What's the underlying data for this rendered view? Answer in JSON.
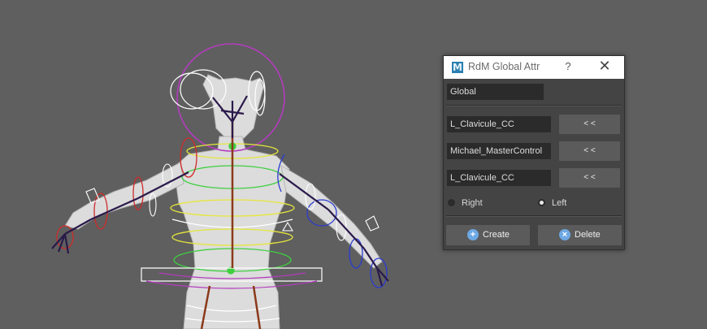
{
  "dialog": {
    "title": "RdM Global Attr",
    "logo_letter": "M",
    "help_label": "?",
    "close_label": "✕",
    "global_field": "Global",
    "rows": [
      {
        "value": "L_Clavicule_CC",
        "button_label": "< <"
      },
      {
        "value": "Michael_MasterControl",
        "button_label": "< <"
      },
      {
        "value": "L_Clavicule_CC",
        "button_label": "< <"
      }
    ],
    "side_options": [
      {
        "label": "Right",
        "selected": false
      },
      {
        "label": "Left",
        "selected": true
      }
    ],
    "create_label": "Create",
    "delete_label": "Delete",
    "create_icon": "plus-icon",
    "delete_icon": "x-icon",
    "colors": {
      "title_bar": "#ffffff",
      "panel": "#444444",
      "field": "#2b2b2b",
      "button": "#5b5b5b",
      "icon_blue": "#6da8e3",
      "logo": "#2a7fb0"
    }
  },
  "viewport": {
    "background": "#5f5f5f",
    "rig_colors": {
      "head_circle": "#b43cbf",
      "spine_rings": "#e6e63c",
      "chest_rings": "#3fcf3f",
      "left_arm": "#2a3ad0",
      "right_arm": "#d02a2a",
      "joints": "#2a1a4a"
    }
  }
}
